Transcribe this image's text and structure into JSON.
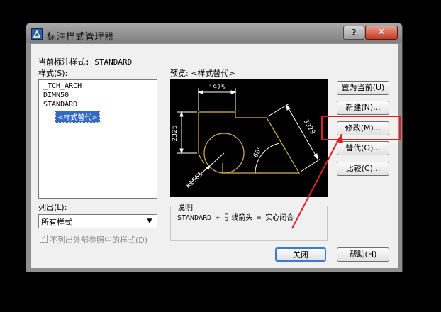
{
  "window": {
    "title": "标注样式管理器",
    "help_label": "?",
    "close_label": "✕"
  },
  "current_style_label": "当前标注样式: STANDARD",
  "styles_label": "样式(S):",
  "styles": [
    "_TCH_ARCH",
    "DIMN50",
    "STANDARD"
  ],
  "selected_style": "<样式替代>",
  "preview_label": "预览: <样式替代>",
  "preview": {
    "dim_top": "1975",
    "dim_left": "2325",
    "dim_diag": "3929",
    "dim_angle": "60°",
    "dim_radius": "R1561"
  },
  "list_label": "列出(L):",
  "list_value": "所有样式",
  "exclude_xref_label": "不列出外部参照中的样式(D)",
  "description_label": "说明",
  "description_text": "STANDARD + 引线箭头 = 实心闭合",
  "buttons": {
    "set_current": "置为当前(U)",
    "new": "新建(N)...",
    "modify": "修改(M)...",
    "override": "替代(O)...",
    "compare": "比较(C)...",
    "close": "关闭",
    "help": "帮助(H)"
  },
  "colors": {
    "highlight": "#e02020",
    "selection": "#3169c6",
    "dimension_lines": "#ffffff",
    "geometry": "#d6b24a"
  }
}
